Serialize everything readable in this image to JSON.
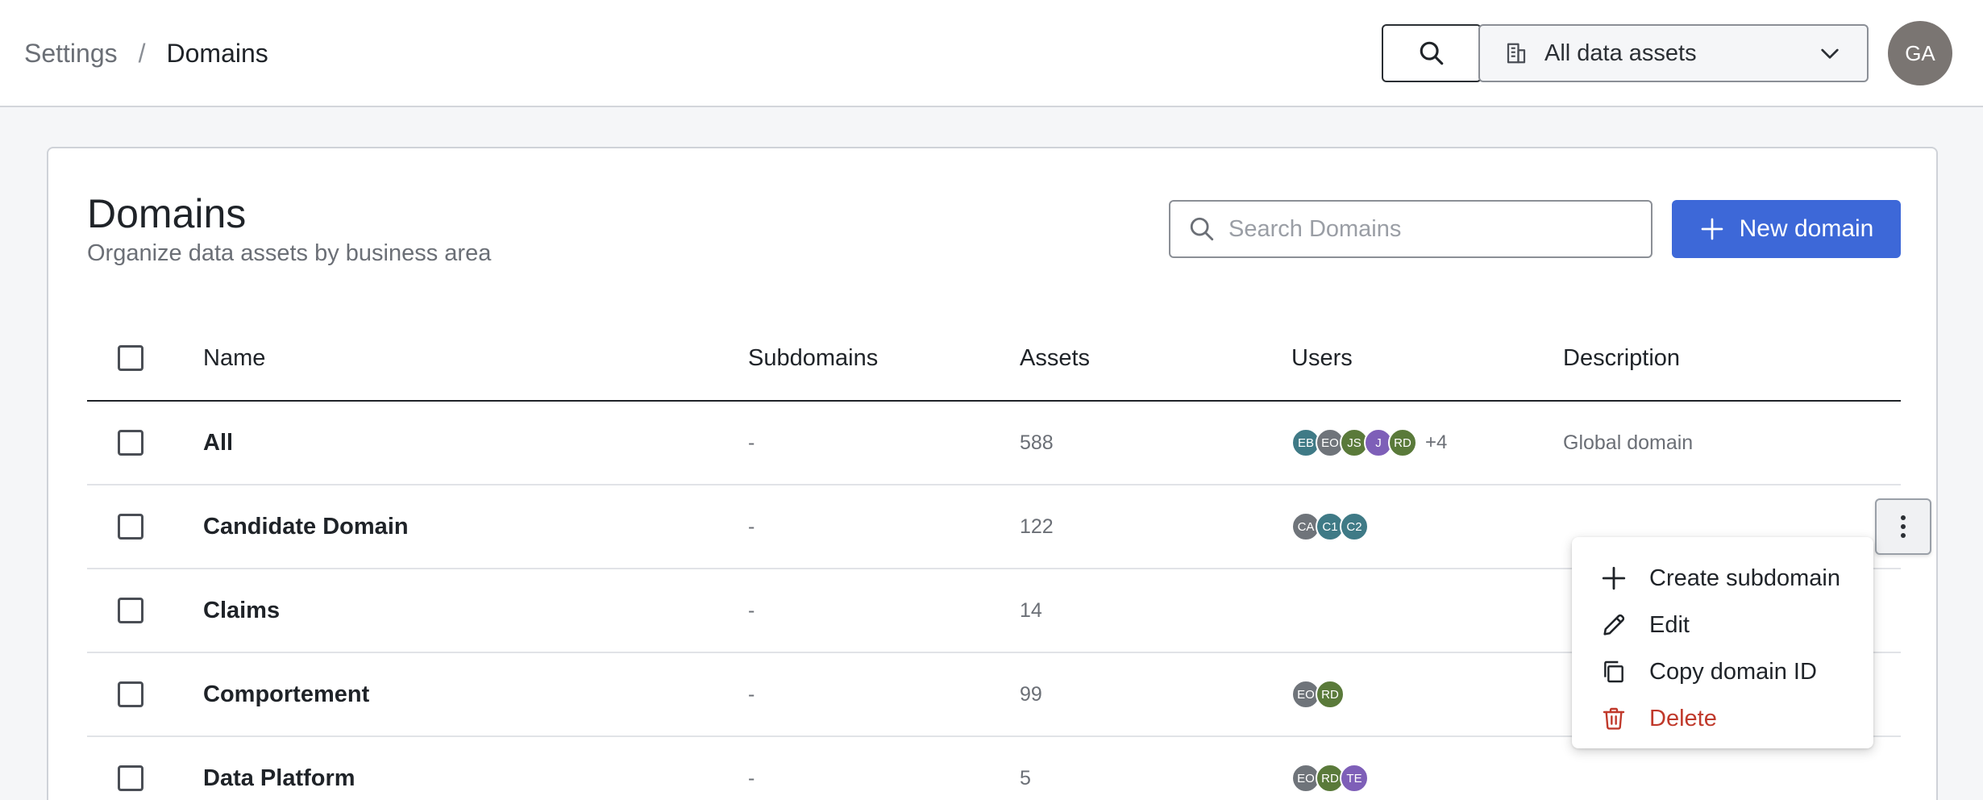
{
  "header": {
    "breadcrumb": {
      "root": "Settings",
      "separator": "/",
      "current": "Domains"
    },
    "search_icon": "search-icon",
    "asset_filter": {
      "icon": "building-icon",
      "value": "All data assets",
      "chevron": "chevron-down-icon"
    },
    "avatar_initials": "GA"
  },
  "page": {
    "title": "Domains",
    "subtitle": "Organize data assets by business area",
    "search_placeholder": "Search Domains",
    "new_button_label": "New domain"
  },
  "table": {
    "columns": {
      "name": "Name",
      "subdomains": "Subdomains",
      "assets": "Assets",
      "users": "Users",
      "description": "Description"
    },
    "rows": [
      {
        "name": "All",
        "subdomains": "-",
        "assets": "588",
        "users": [
          {
            "initials": "EB",
            "color": "#3f7a86"
          },
          {
            "initials": "EO",
            "color": "#6f747a"
          },
          {
            "initials": "JS",
            "color": "#5a7a3a"
          },
          {
            "initials": "J",
            "color": "#7e5fb8"
          },
          {
            "initials": "RD",
            "color": "#5a7a3a"
          }
        ],
        "users_more": "+4",
        "description": "Global domain"
      },
      {
        "name": "Candidate Domain",
        "subdomains": "-",
        "assets": "122",
        "users": [
          {
            "initials": "CA",
            "color": "#6f747a"
          },
          {
            "initials": "C1",
            "color": "#3f7a86"
          },
          {
            "initials": "C2",
            "color": "#3f7a86"
          }
        ],
        "users_more": "",
        "description": ""
      },
      {
        "name": "Claims",
        "subdomains": "-",
        "assets": "14",
        "users": [],
        "users_more": "",
        "description": ""
      },
      {
        "name": "Comportement",
        "subdomains": "-",
        "assets": "99",
        "users": [
          {
            "initials": "EO",
            "color": "#6f747a"
          },
          {
            "initials": "RD",
            "color": "#5a7a3a"
          }
        ],
        "users_more": "",
        "description": ""
      },
      {
        "name": "Data Platform",
        "subdomains": "-",
        "assets": "5",
        "users": [
          {
            "initials": "EO",
            "color": "#6f747a"
          },
          {
            "initials": "RD",
            "color": "#5a7a3a"
          },
          {
            "initials": "TE",
            "color": "#7e5fb8"
          }
        ],
        "users_more": "",
        "description": ""
      }
    ]
  },
  "context_menu": {
    "items": [
      {
        "label": "Create subdomain",
        "icon": "plus-icon"
      },
      {
        "label": "Edit",
        "icon": "pencil-icon"
      },
      {
        "label": "Copy domain ID",
        "icon": "copy-icon"
      },
      {
        "label": "Delete",
        "icon": "trash-icon"
      }
    ]
  },
  "colors": {
    "primary": "#3d68d8",
    "danger": "#c0392b",
    "text": "#1f2328",
    "muted": "#6b6f76"
  }
}
